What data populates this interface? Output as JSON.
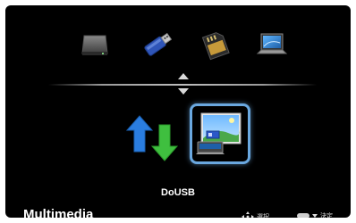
{
  "sources": [
    {
      "name": "hard-drive-icon"
    },
    {
      "name": "usb-flash-drive-icon"
    },
    {
      "name": "sd-card-icon"
    },
    {
      "name": "laptop-icon"
    }
  ],
  "apps": [
    {
      "name": "network-transfer-icon"
    },
    {
      "name": "usb-display-icon"
    }
  ],
  "selected_app_label": "DoUSB",
  "footer": {
    "title": "Multimedia",
    "hint_select": "選択",
    "hint_confirm": "決定"
  },
  "colors": {
    "background": "#000000",
    "selection_border": "#6aa8e0",
    "arrow_blue": "#2a7de0",
    "arrow_green": "#3fbf3f"
  }
}
